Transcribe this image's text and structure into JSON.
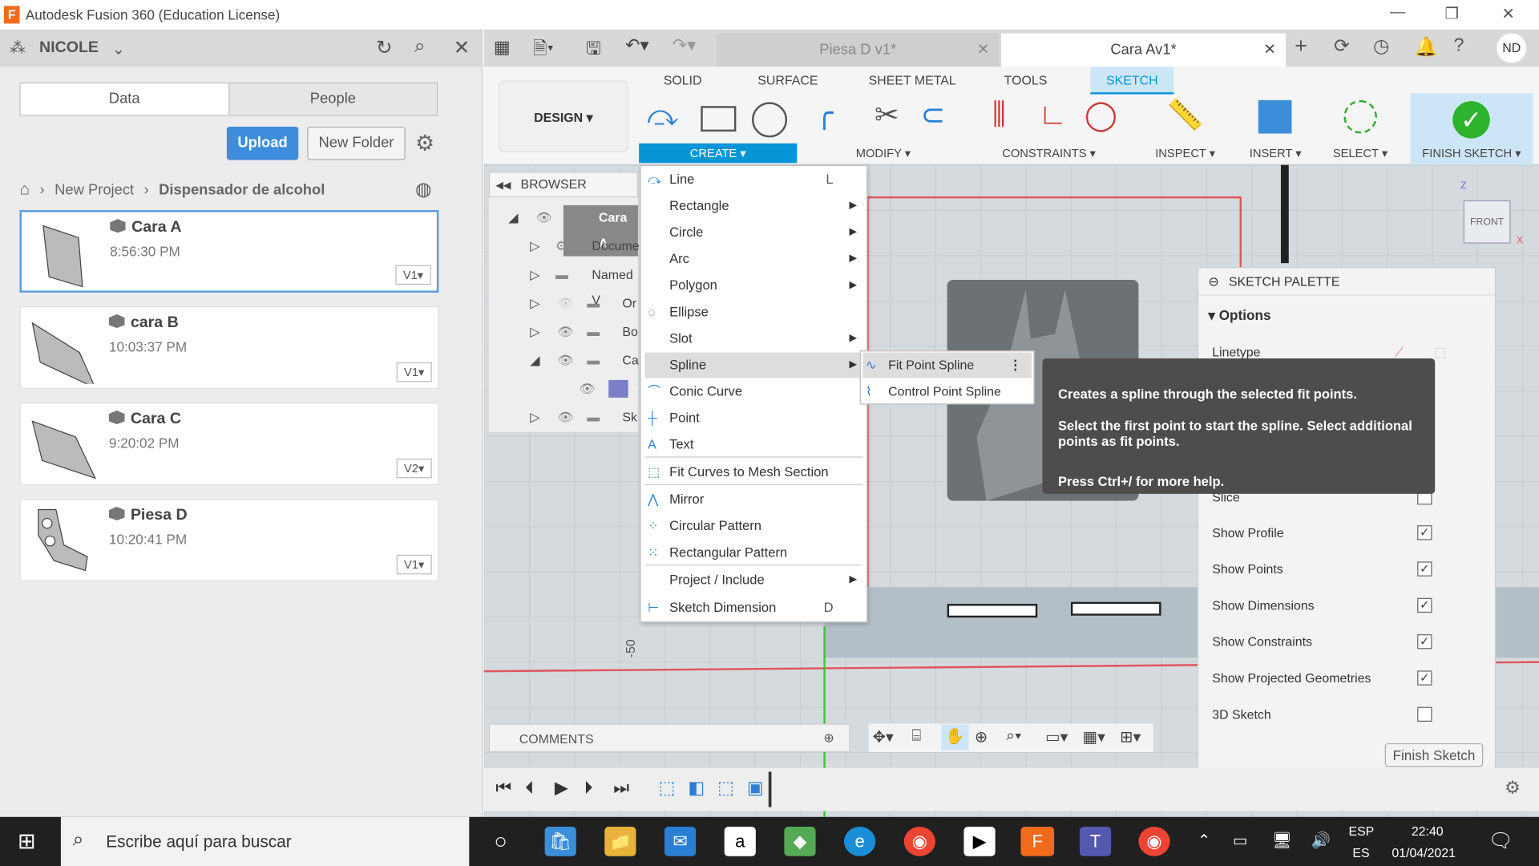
{
  "window": {
    "title": "Autodesk Fusion 360 (Education License)",
    "minimize": "—",
    "restore": "❐",
    "close": "✕"
  },
  "data_panel": {
    "user": "NICOLE",
    "tabs": [
      "Data",
      "People"
    ],
    "upload": "Upload",
    "new_folder": "New Folder",
    "breadcrumb": [
      "New Project",
      "Dispensador de alcohol"
    ],
    "files": [
      {
        "name": "Cara A",
        "time": "8:56:30 PM",
        "version": "V1"
      },
      {
        "name": "cara B",
        "time": "10:03:37 PM",
        "version": "V1"
      },
      {
        "name": "Cara C",
        "time": "9:20:02 PM",
        "version": "V2"
      },
      {
        "name": "Piesa D",
        "time": "10:20:41 PM",
        "version": "V1"
      }
    ]
  },
  "doc_tabs": [
    {
      "label": "Piesa D v1*",
      "active": false
    },
    {
      "label": "Cara Av1*",
      "active": true
    }
  ],
  "user_initials": "ND",
  "ribbon": {
    "workspace": "DESIGN ▾",
    "tabs": [
      "SOLID",
      "SURFACE",
      "SHEET METAL",
      "TOOLS",
      "SKETCH"
    ],
    "active_tab": "SKETCH",
    "groups": [
      "CREATE ▾",
      "MODIFY ▾",
      "CONSTRAINTS ▾",
      "INSPECT ▾",
      "INSERT ▾",
      "SELECT ▾",
      "FINISH SKETCH ▾"
    ],
    "accent": "#0696d7"
  },
  "browser": {
    "title": "BROWSER",
    "items": [
      "Cara A",
      "Docume",
      "Named V",
      "Or",
      "Bo",
      "Ca",
      "Sk"
    ]
  },
  "create_menu": [
    {
      "label": "Line",
      "shortcut": "L"
    },
    {
      "label": "Rectangle",
      "sub": true
    },
    {
      "label": "Circle",
      "sub": true
    },
    {
      "label": "Arc",
      "sub": true
    },
    {
      "label": "Polygon",
      "sub": true
    },
    {
      "label": "Ellipse"
    },
    {
      "label": "Slot",
      "sub": true
    },
    {
      "label": "Spline",
      "sub": true,
      "highlight": true
    },
    {
      "label": "Conic Curve"
    },
    {
      "label": "Point"
    },
    {
      "label": "Text"
    },
    {
      "label": "Fit Curves to Mesh Section"
    },
    {
      "label": "Mirror"
    },
    {
      "label": "Circular Pattern"
    },
    {
      "label": "Rectangular Pattern"
    },
    {
      "label": "Project / Include",
      "sub": true
    },
    {
      "label": "Sketch Dimension",
      "shortcut": "D"
    }
  ],
  "spline_submenu": [
    "Fit Point Spline",
    "Control Point Spline"
  ],
  "tooltip": {
    "line1": "Creates a spline through the selected fit points.",
    "line2": "Select the first point to start the spline. Select additional points as fit points.",
    "line3": "Press Ctrl+/ for more help."
  },
  "sketch_palette": {
    "title": "SKETCH PALETTE",
    "section": "Options",
    "linetype": "Linetype",
    "slice": "Slice",
    "options": [
      {
        "label": "Show Profile",
        "checked": true
      },
      {
        "label": "Show Points",
        "checked": true
      },
      {
        "label": "Show Dimensions",
        "checked": true
      },
      {
        "label": "Show Constraints",
        "checked": true
      },
      {
        "label": "Show Projected Geometries",
        "checked": true
      },
      {
        "label": "3D Sketch",
        "checked": false
      }
    ],
    "finish": "Finish Sketch"
  },
  "viewcube": {
    "face": "FRONT",
    "axis_z": "Z",
    "axis_x": "X"
  },
  "dimension_label": "-50",
  "comments": "COMMENTS",
  "taskbar": {
    "search": "Escribe aquí para buscar",
    "lang1": "ESP",
    "lang2": "ES",
    "time": "22:40",
    "date": "01/04/2021"
  }
}
